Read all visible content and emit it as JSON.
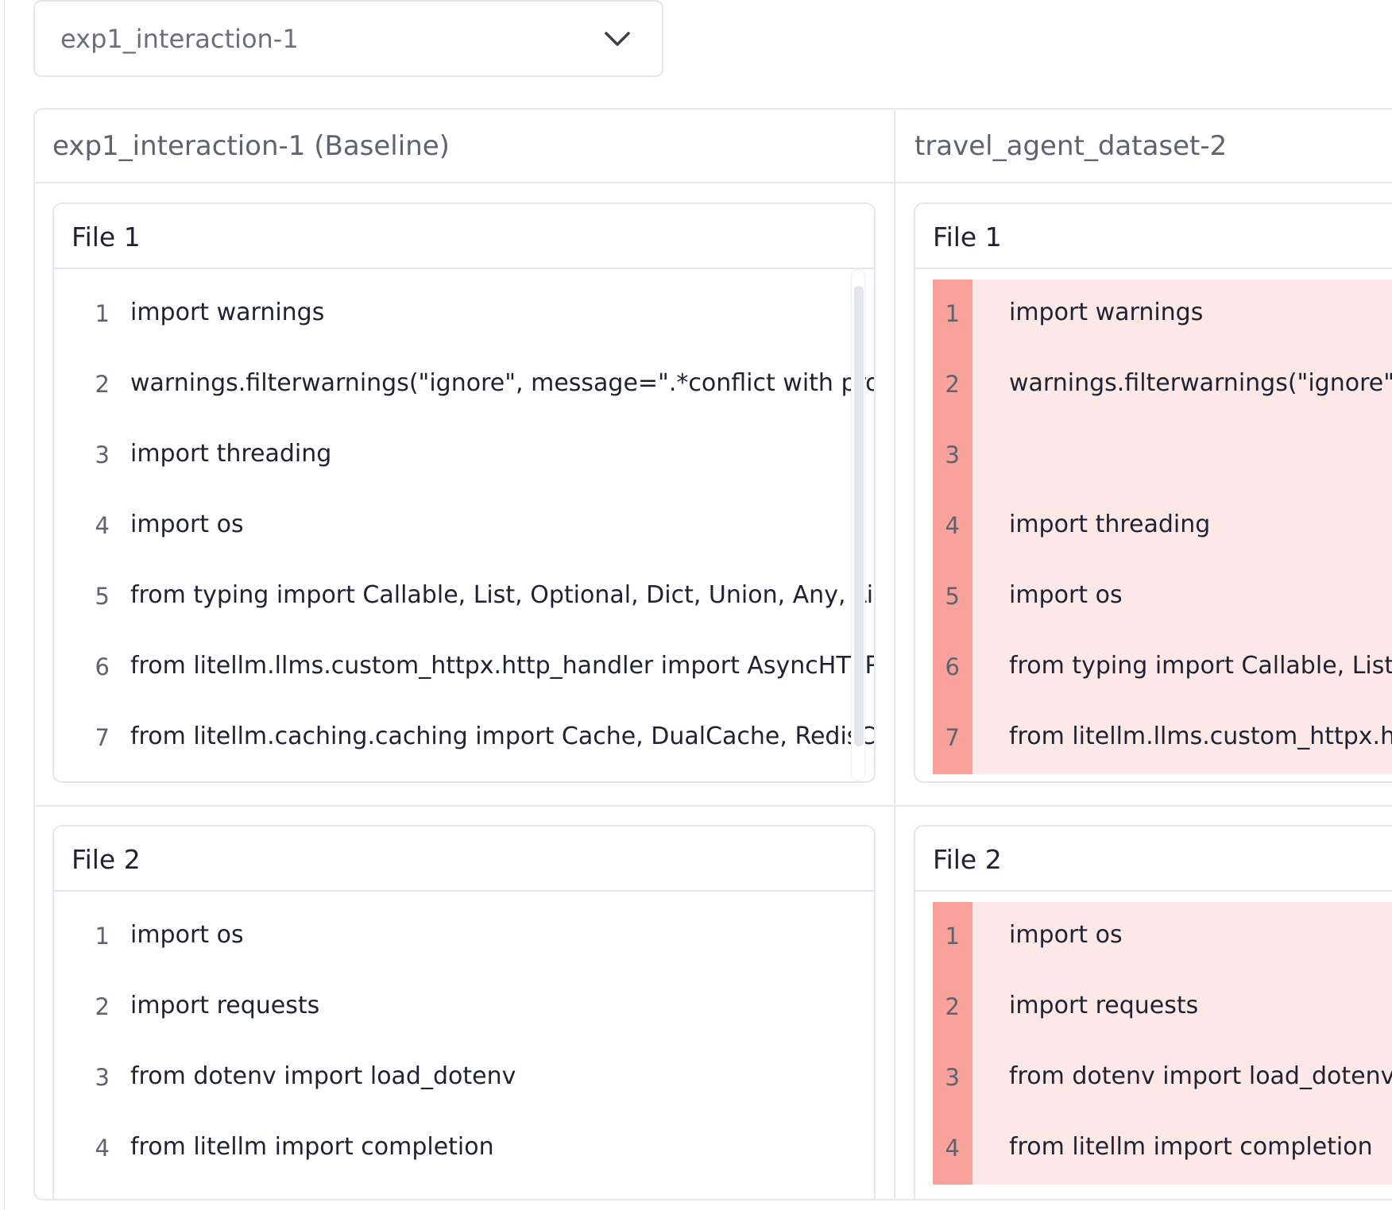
{
  "selector": {
    "value": "exp1_interaction-1",
    "icon": "chevron-down-icon"
  },
  "columns": [
    {
      "title": "exp1_interaction-1 (Baseline)"
    },
    {
      "title": "travel_agent_dataset-2"
    }
  ],
  "baseline": {
    "file1": {
      "title": "File 1",
      "lines": [
        {
          "n": "1",
          "code": "import warnings"
        },
        {
          "n": "2",
          "code": "warnings.filterwarnings(\"ignore\", message=\".*conflict with prot"
        },
        {
          "n": "3",
          "code": "import threading"
        },
        {
          "n": "4",
          "code": "import os"
        },
        {
          "n": "5",
          "code": "from typing import Callable, List, Optional, Dict, Union, Any, Liter"
        },
        {
          "n": "6",
          "code": "from litellm.llms.custom_httpx.http_handler import AsyncHTTPHa"
        },
        {
          "n": "7",
          "code": "from litellm.caching.caching import Cache, DualCache, RedisCache"
        }
      ]
    },
    "file2": {
      "title": "File 2",
      "lines": [
        {
          "n": "1",
          "code": "import os"
        },
        {
          "n": "2",
          "code": "import requests"
        },
        {
          "n": "3",
          "code": "from dotenv import load_dotenv"
        },
        {
          "n": "4",
          "code": "from litellm import completion"
        }
      ]
    }
  },
  "compare": {
    "file1": {
      "title": "File 1",
      "lines": [
        {
          "n": "1",
          "code": "import warnings"
        },
        {
          "n": "2",
          "code": "warnings.filterwarnings(\"ignore\", message=\".*conflict with prot"
        },
        {
          "n": "3",
          "code": ""
        },
        {
          "n": "4",
          "code": "import threading"
        },
        {
          "n": "5",
          "code": "import os"
        },
        {
          "n": "6",
          "code": "from typing import Callable, List, Optional, Dict, Union, Any, Liter"
        },
        {
          "n": "7",
          "code": "from litellm.llms.custom_httpx.http_handler import AsyncHTTPHa"
        }
      ]
    },
    "file2": {
      "title": "File 2",
      "lines": [
        {
          "n": "1",
          "code": "import os"
        },
        {
          "n": "2",
          "code": "import requests"
        },
        {
          "n": "3",
          "code": "from dotenv import load_dotenv"
        },
        {
          "n": "4",
          "code": "from litellm import completion"
        }
      ]
    }
  },
  "colors": {
    "diff_gutter": "#f8a29b",
    "diff_background": "#fde8e8"
  }
}
